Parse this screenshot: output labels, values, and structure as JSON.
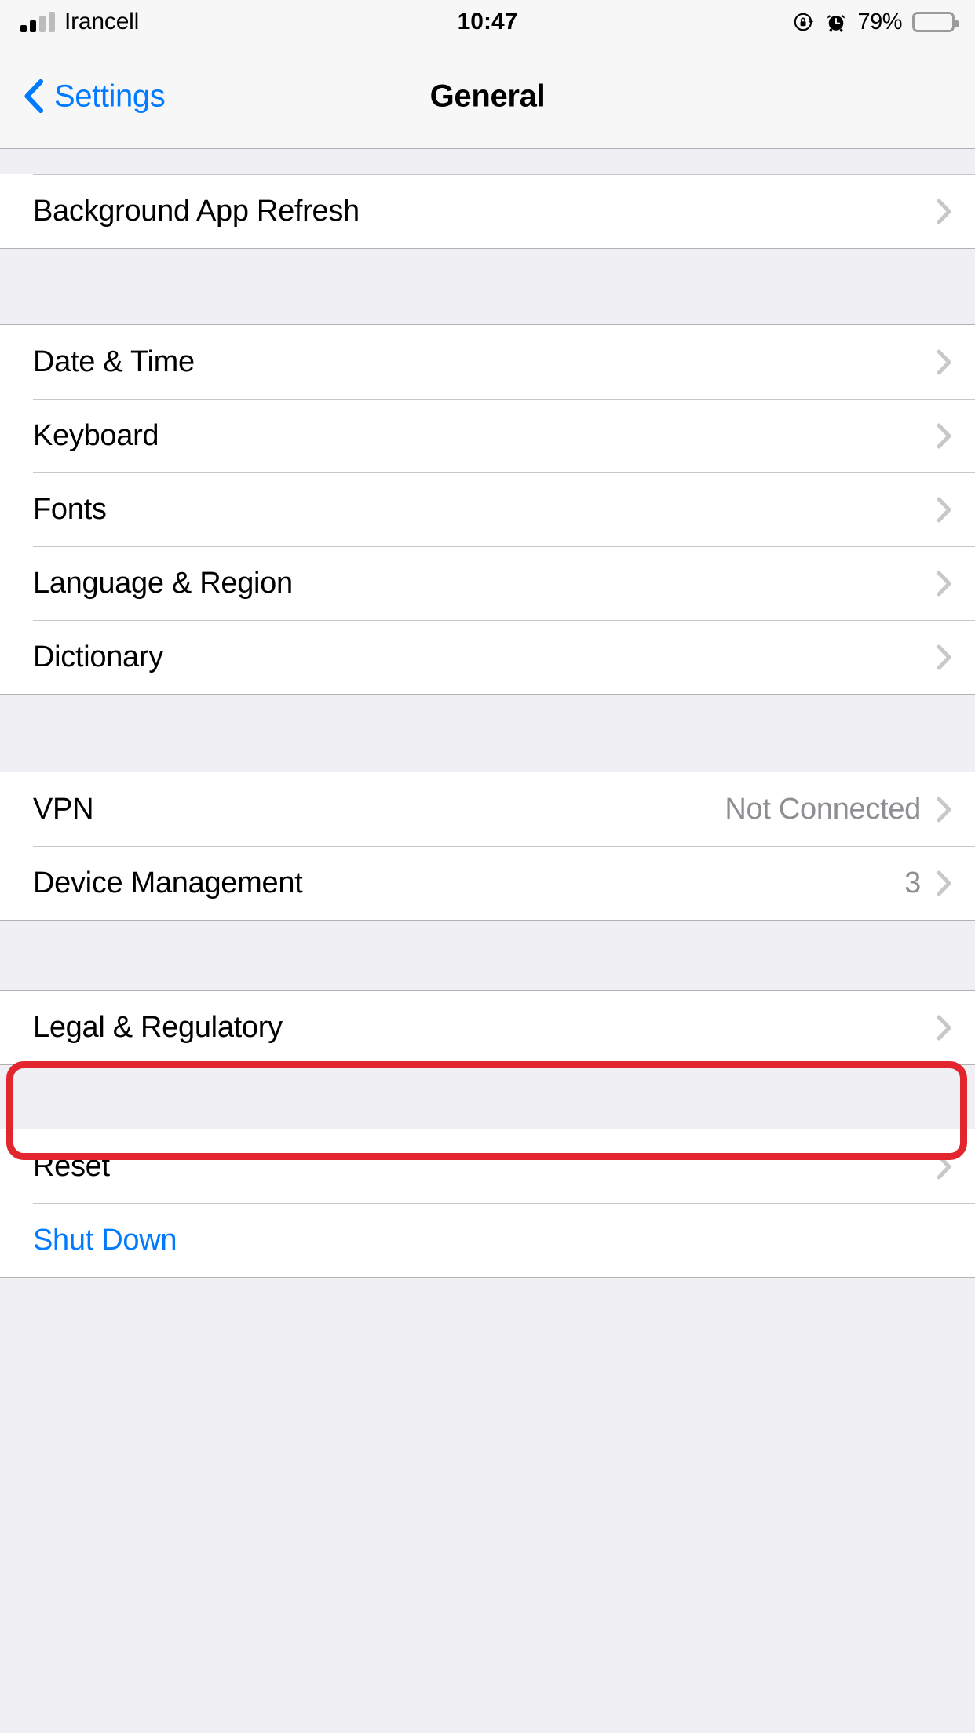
{
  "status_bar": {
    "carrier": "Irancell",
    "time": "10:47",
    "battery_percent": "79%",
    "icons": {
      "signal": "signal-bars-icon",
      "rotation_lock": "rotation-lock-icon",
      "alarm": "alarm-clock-icon",
      "battery": "battery-icon"
    },
    "signal_bars_filled": 2,
    "signal_bars_total": 4
  },
  "nav_bar": {
    "back_label": "Settings",
    "title": "General",
    "back_icon": "chevron-left-icon"
  },
  "colors": {
    "accent_blue": "#007AFF",
    "highlight_red": "#E3262E",
    "value_gray": "#8E8E93",
    "chevron_gray": "#C7C7CC",
    "group_bg": "#EFEFF4",
    "bar_bg": "#F7F7F7"
  },
  "sections": [
    {
      "id": "background-app-refresh",
      "rows": [
        {
          "label": "Background App Refresh",
          "value": "",
          "chevron": true,
          "style": "default"
        }
      ]
    },
    {
      "id": "locale",
      "rows": [
        {
          "label": "Date & Time",
          "value": "",
          "chevron": true,
          "style": "default"
        },
        {
          "label": "Keyboard",
          "value": "",
          "chevron": true,
          "style": "default"
        },
        {
          "label": "Fonts",
          "value": "",
          "chevron": true,
          "style": "default"
        },
        {
          "label": "Language & Region",
          "value": "",
          "chevron": true,
          "style": "default"
        },
        {
          "label": "Dictionary",
          "value": "",
          "chevron": true,
          "style": "default"
        }
      ]
    },
    {
      "id": "network-management",
      "rows": [
        {
          "label": "VPN",
          "value": "Not Connected",
          "chevron": true,
          "style": "default"
        },
        {
          "label": "Device Management",
          "value": "3",
          "chevron": true,
          "style": "default",
          "highlighted": true
        }
      ]
    },
    {
      "id": "legal",
      "rows": [
        {
          "label": "Legal & Regulatory",
          "value": "",
          "chevron": true,
          "style": "default"
        }
      ]
    },
    {
      "id": "reset-shutdown",
      "rows": [
        {
          "label": "Reset",
          "value": "",
          "chevron": true,
          "style": "default"
        },
        {
          "label": "Shut Down",
          "value": "",
          "chevron": false,
          "style": "link"
        }
      ]
    }
  ]
}
